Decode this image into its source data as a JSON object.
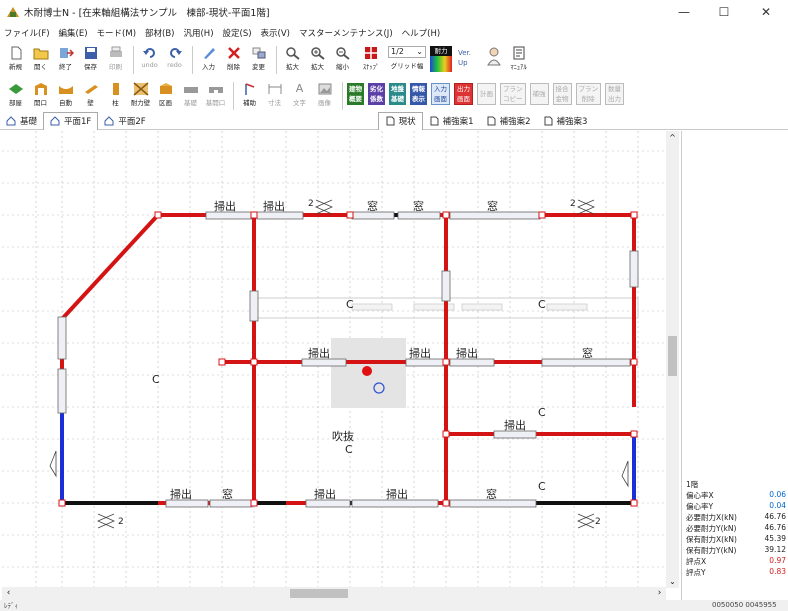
{
  "window": {
    "title": "木耐博士N - [在来軸組構法サンプル　棟部-現状-平面1階]",
    "minimize": "—",
    "maximize": "☐",
    "close": "✕"
  },
  "menu": [
    "ファイル(F)",
    "編集(E)",
    "モード(M)",
    "部材(B)",
    "汎用(H)",
    "設定(S)",
    "表示(V)",
    "マスターメンテナンス(J)",
    "ヘルプ(H)"
  ],
  "toolbar1": [
    {
      "label": "新規",
      "icon": "new-file-icon"
    },
    {
      "label": "開く",
      "icon": "open-folder-icon"
    },
    {
      "label": "終了",
      "icon": "exit-icon"
    },
    {
      "label": "保存",
      "icon": "save-icon"
    },
    {
      "label": "印刷",
      "icon": "print-icon"
    },
    {
      "label": "undo",
      "icon": "undo-icon"
    },
    {
      "label": "redo",
      "icon": "redo-icon"
    },
    {
      "label": "入力",
      "icon": "pencil-icon"
    },
    {
      "label": "削除",
      "icon": "delete-x-icon"
    },
    {
      "label": "変更",
      "icon": "change-icon"
    },
    {
      "label": "拡大",
      "icon": "zoom-icon"
    },
    {
      "label": "拡大",
      "icon": "zoom-in-icon"
    },
    {
      "label": "縮小",
      "icon": "zoom-out-icon"
    },
    {
      "label": "ｽﾅｯﾌﾟ",
      "icon": "snap-icon"
    }
  ],
  "grid": {
    "value": "1/2",
    "label": "グリッド幅"
  },
  "toolbar1_extra": {
    "taryoku": "耐力",
    "ver_line1": "Ver.",
    "ver_line2": "Up",
    "manual": "ﾏﾆｭｱﾙ"
  },
  "toolbar2": [
    {
      "label": "部屋",
      "icon": "room-icon"
    },
    {
      "label": "開口",
      "icon": "opening-icon"
    },
    {
      "label": "自動",
      "icon": "auto-icon"
    },
    {
      "label": "壁",
      "icon": "wall-icon"
    },
    {
      "label": "柱",
      "icon": "column-icon"
    },
    {
      "label": "耐力壁",
      "icon": "bearing-wall-icon"
    },
    {
      "label": "区画",
      "icon": "section-icon"
    },
    {
      "label": "基礎",
      "icon": "foundation-icon"
    },
    {
      "label": "基開口",
      "icon": "foundation-opening-icon"
    },
    {
      "label": "補助",
      "icon": "aux-line-icon"
    },
    {
      "label": "寸法",
      "icon": "dimension-icon"
    },
    {
      "label": "文字",
      "icon": "text-icon"
    },
    {
      "label": "画像",
      "icon": "image-icon"
    }
  ],
  "toolbar2_boxes": [
    {
      "l1": "建物",
      "l2": "概要",
      "style": "c",
      "bg": "#2a7a2a"
    },
    {
      "l1": "劣化",
      "l2": "係数",
      "style": "c",
      "bg": "#5b3ea6"
    },
    {
      "l1": "地盤",
      "l2": "基礎",
      "style": "c",
      "bg": "#2b8a8a"
    },
    {
      "l1": "情報",
      "l2": "表示",
      "style": "c",
      "bg": "#3558a8"
    },
    {
      "l1": "入力",
      "l2": "画面",
      "style": "i",
      "bg": ""
    },
    {
      "l1": "出力",
      "l2": "画面",
      "style": "r",
      "bg": ""
    },
    {
      "l1": "計画",
      "l2": "",
      "style": "g",
      "bg": ""
    },
    {
      "l1": "プラン",
      "l2": "コピー",
      "style": "g",
      "bg": ""
    },
    {
      "l1": "補強",
      "l2": "",
      "style": "g",
      "bg": ""
    },
    {
      "l1": "接合",
      "l2": "金物",
      "style": "g",
      "bg": ""
    },
    {
      "l1": "プラン",
      "l2": "削除",
      "style": "g",
      "bg": ""
    },
    {
      "l1": "数量",
      "l2": "出力",
      "style": "g",
      "bg": ""
    }
  ],
  "floor_tabs": [
    "基礎",
    "平面1F",
    "平面2F"
  ],
  "plan_tabs": [
    "現状",
    "補強案1",
    "補強案2",
    "補強案3"
  ],
  "plan": {
    "sweep": "掃出",
    "window": "窓",
    "room_c": "C",
    "stair_label": "吹抜",
    "arrow2": "2"
  },
  "panel": {
    "floor": "1階",
    "rows": [
      {
        "label": "偏心率X",
        "value": "0.06"
      },
      {
        "label": "偏心率Y",
        "value": "0.04"
      },
      {
        "label": "必要耐力X(kN)",
        "value": "46.76"
      },
      {
        "label": "必要耐力Y(kN)",
        "value": "46.76"
      },
      {
        "label": "保有耐力X(kN)",
        "value": "45.39"
      },
      {
        "label": "保有耐力Y(kN)",
        "value": "39.12"
      },
      {
        "label": "評点X",
        "value": "0.97"
      },
      {
        "label": "評点Y",
        "value": "0.83"
      }
    ]
  },
  "status": {
    "left": "ﾚﾃﾞｨ",
    "coords": "0050050  0045955"
  },
  "colors": {
    "red_wall": "#d41414",
    "blue_wall": "#1b2fd8",
    "black_wall": "#111111",
    "selection": "#e4e4e4"
  }
}
